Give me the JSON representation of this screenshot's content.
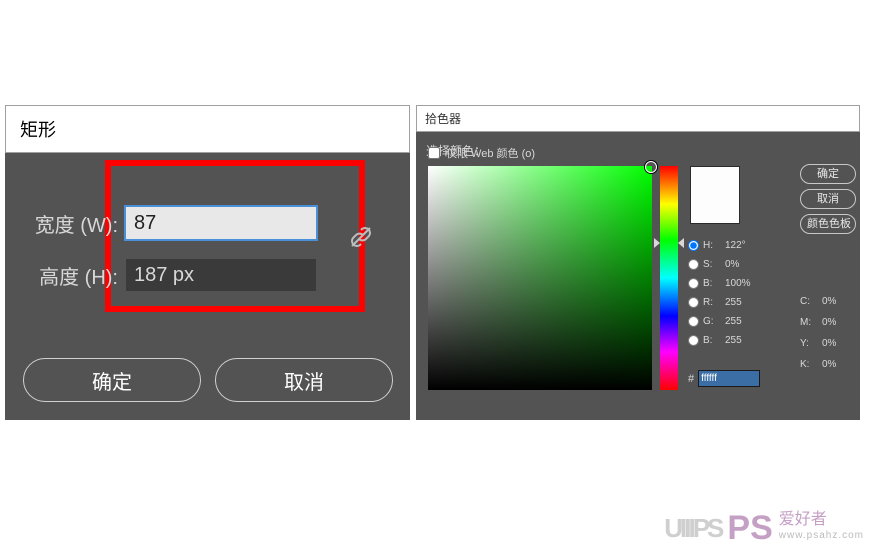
{
  "rect": {
    "title": "矩形",
    "width_label": "宽度 (W):",
    "height_label": "高度 (H):",
    "width_value": "87",
    "height_value": "187 px",
    "ok": "确定",
    "cancel": "取消"
  },
  "picker": {
    "title": "拾色器",
    "select_label": "选择颜色：",
    "actions": {
      "ok": "确定",
      "cancel": "取消",
      "libs": "颜色色板"
    },
    "modes": {
      "H": "122°",
      "S": "0%",
      "B": "100%",
      "R": "255",
      "G": "255",
      "Bv": "255"
    },
    "cmyk": {
      "C": "0%",
      "M": "0%",
      "Y": "0%",
      "K": "0%"
    },
    "hex": "ffffff",
    "webonly": "仅限 Web 颜色 (o)"
  },
  "watermark": {
    "logo": "UIIIPS",
    "ps": "PS",
    "txt": "爱好者",
    "url": "www.psahz.com"
  },
  "colors": {
    "accent": "#ff0000",
    "hue_pick": "#00ff00"
  }
}
